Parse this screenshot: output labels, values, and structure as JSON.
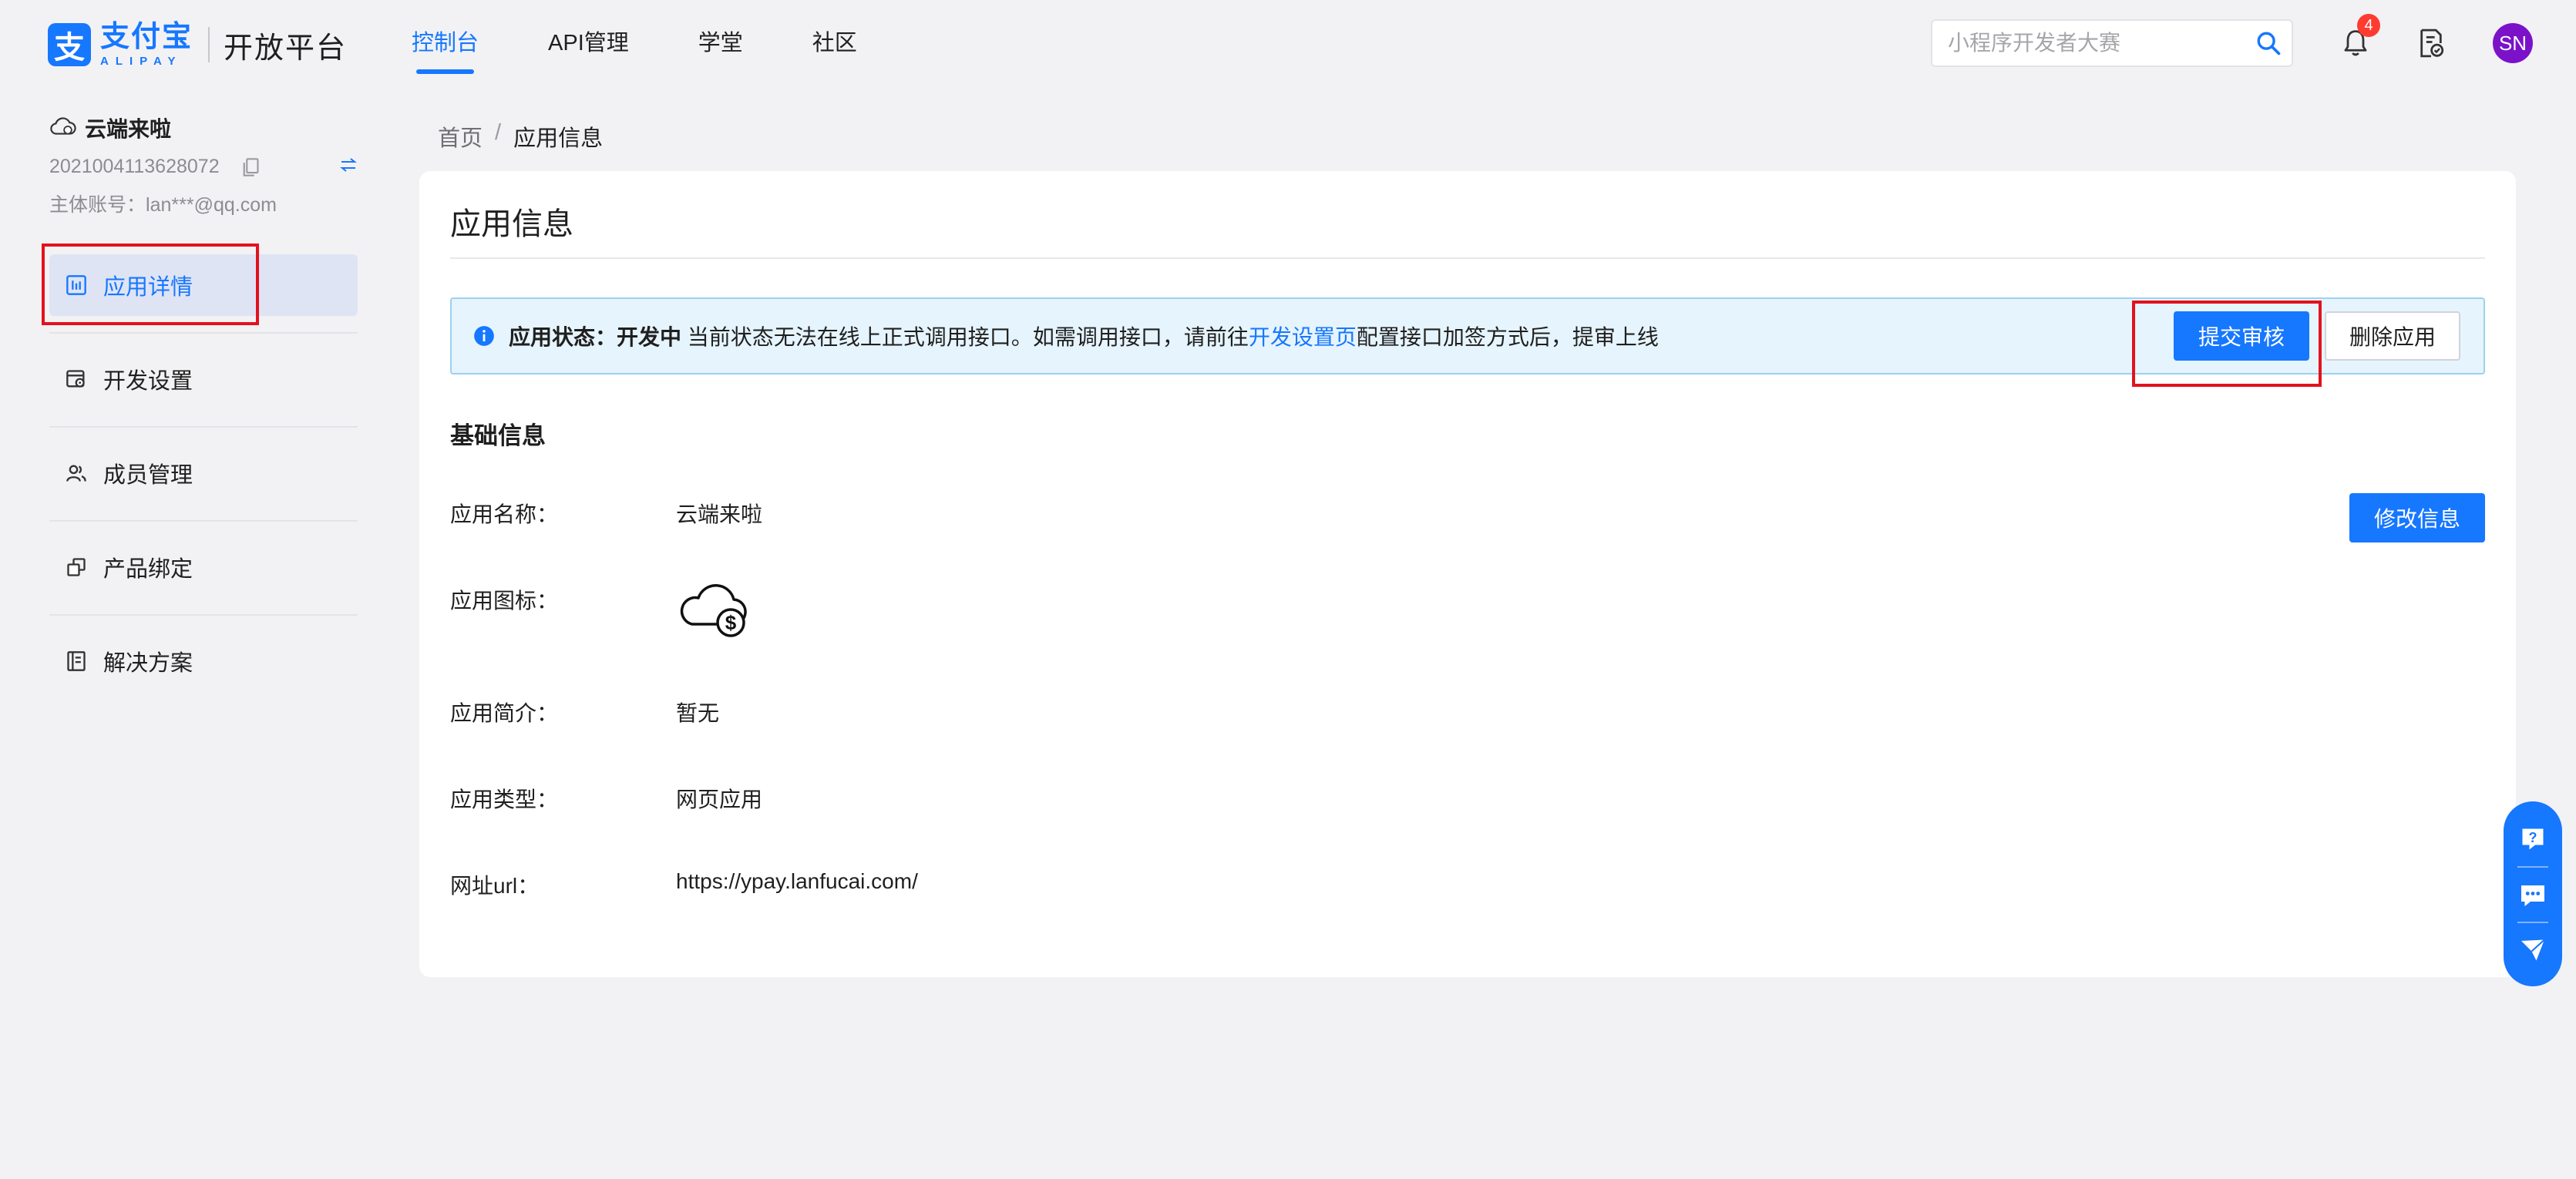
{
  "header": {
    "logo_mark": "支",
    "logo_cn": "支付宝",
    "logo_en": "ALIPAY",
    "platform": "开放平台",
    "nav": [
      {
        "label": "控制台",
        "active": true
      },
      {
        "label": "API管理",
        "active": false
      },
      {
        "label": "学堂",
        "active": false
      },
      {
        "label": "社区",
        "active": false
      }
    ],
    "search_placeholder": "小程序开发者大赛",
    "notification_count": "4",
    "avatar_text": "SN"
  },
  "sidebar": {
    "app_name": "云端来啦",
    "app_id": "2021004113628072",
    "account_label": "主体账号：",
    "account": "lan***@qq.com",
    "menu": [
      {
        "label": "应用详情",
        "icon": "chart-icon",
        "active": true
      },
      {
        "label": "开发设置",
        "icon": "settings-window-icon",
        "active": false
      },
      {
        "label": "成员管理",
        "icon": "members-icon",
        "active": false
      },
      {
        "label": "产品绑定",
        "icon": "product-bind-icon",
        "active": false
      },
      {
        "label": "解决方案",
        "icon": "solution-icon",
        "active": false
      }
    ]
  },
  "breadcrumb": {
    "home": "首页",
    "separator": "/",
    "current": "应用信息"
  },
  "main": {
    "title": "应用信息",
    "alert": {
      "status_label": "应用状态：",
      "status_value": "开发中",
      "text_before": " 当前状态无法在线上正式调用接口。如需调用接口，请前往",
      "link": "开发设置页",
      "text_after": "配置接口加签方式后，提审上线"
    },
    "submit_button": "提交审核",
    "delete_button": "删除应用",
    "section_title": "基础信息",
    "edit_button": "修改信息",
    "fields": {
      "name_label": "应用名称：",
      "name_value": "云端来啦",
      "icon_label": "应用图标：",
      "intro_label": "应用简介：",
      "intro_value": "暂无",
      "type_label": "应用类型：",
      "type_value": "网页应用",
      "url_label": "网址url：",
      "url_value": "https://ypay.lanfucai.com/"
    }
  },
  "colors": {
    "accent": "#1677ff",
    "highlight_box": "#e3121c",
    "badge": "#ff3b30",
    "avatar_bg": "#7b12c9",
    "alert_bg": "#e6f4fd"
  }
}
